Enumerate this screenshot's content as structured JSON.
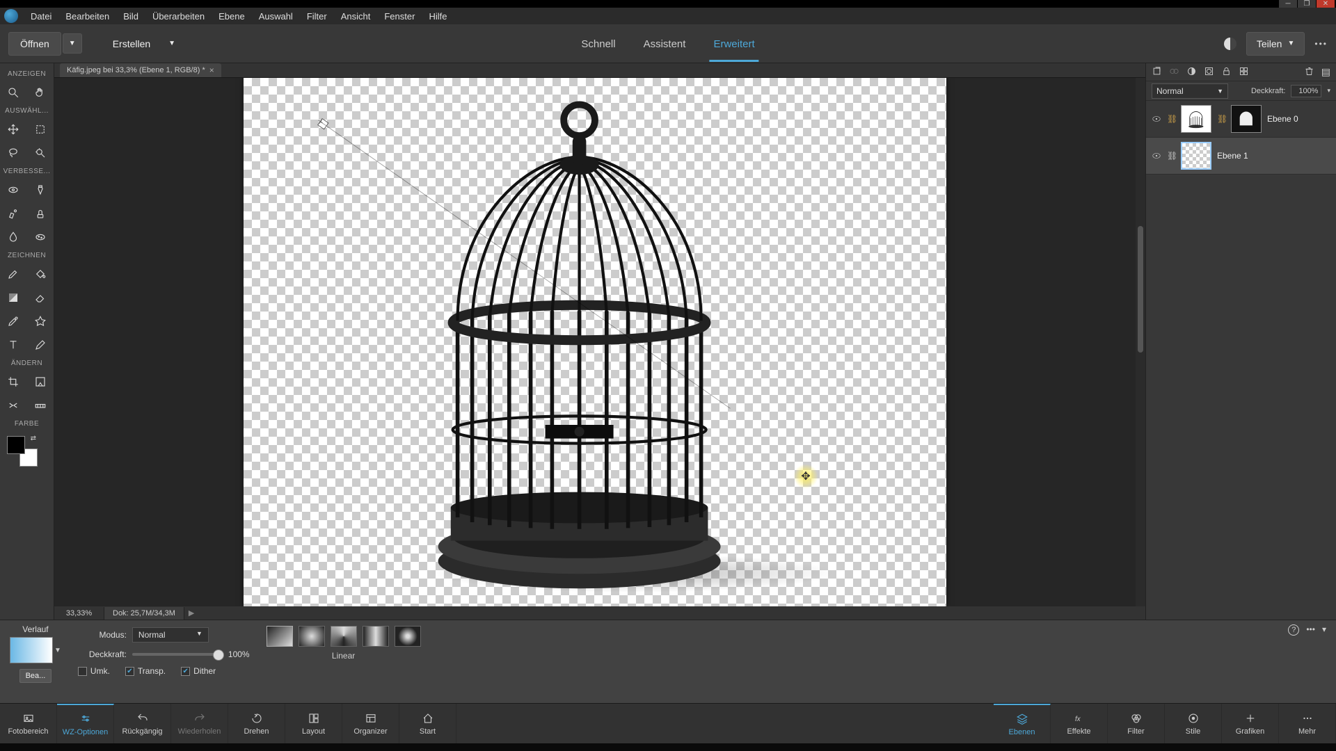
{
  "menu": [
    "Datei",
    "Bearbeiten",
    "Bild",
    "Überarbeiten",
    "Ebene",
    "Auswahl",
    "Filter",
    "Ansicht",
    "Fenster",
    "Hilfe"
  ],
  "optbar": {
    "open": "Öffnen",
    "create": "Erstellen",
    "share": "Teilen"
  },
  "modes": {
    "quick": "Schnell",
    "guided": "Assistent",
    "expert": "Erweitert"
  },
  "toolHeads": {
    "view": "ANZEIGEN",
    "select": "AUSWÄHL...",
    "enhance": "VERBESSE...",
    "draw": "ZEICHNEN",
    "modify": "ÄNDERN",
    "color": "FARBE"
  },
  "docTab": "Käfig.jpeg bei 33,3% (Ebene 1, RGB/8) *",
  "status": {
    "zoom": "33,33%",
    "doc": "Dok: 25,7M/34,3M"
  },
  "layers": {
    "blendMode": "Normal",
    "opacityLabel": "Deckkraft:",
    "opacityValue": "100%",
    "items": [
      {
        "name": "Ebene 0"
      },
      {
        "name": "Ebene 1"
      }
    ]
  },
  "toolopts": {
    "title": "Verlauf",
    "edit": "Bea...",
    "modeLbl": "Modus:",
    "modeVal": "Normal",
    "opacLbl": "Deckkraft:",
    "opacVal": "100%",
    "reverse": "Umk.",
    "transp": "Transp.",
    "dither": "Dither",
    "typeLabel": "Linear"
  },
  "taskbar": {
    "left": [
      "Fotobereich",
      "WZ-Optionen",
      "Rückgängig",
      "Wiederholen",
      "Drehen",
      "Layout",
      "Organizer",
      "Start"
    ],
    "right": [
      "Ebenen",
      "Effekte",
      "Filter",
      "Stile",
      "Grafiken",
      "Mehr"
    ]
  }
}
